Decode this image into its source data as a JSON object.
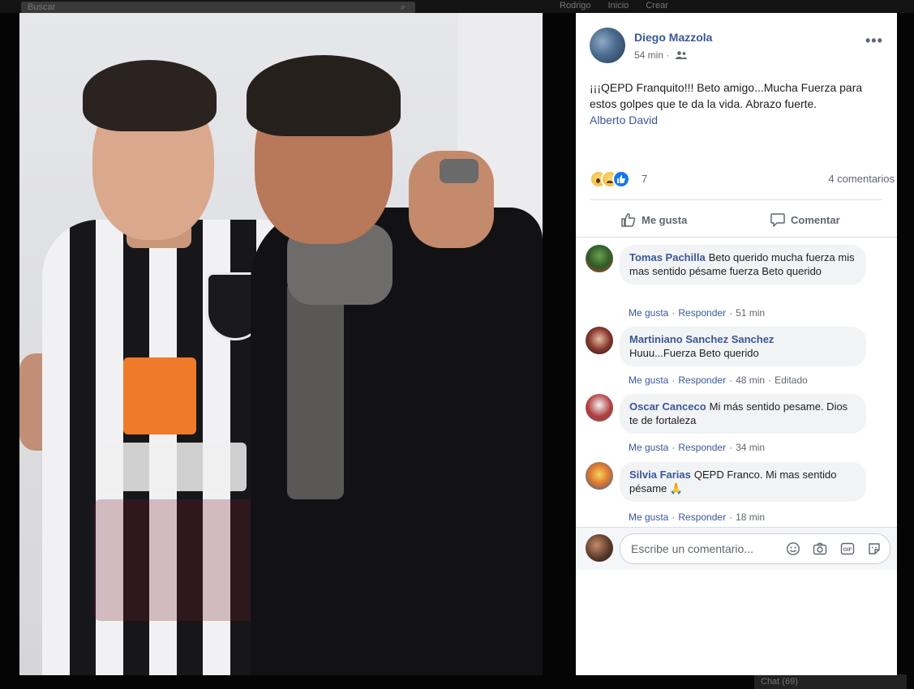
{
  "background": {
    "search_placeholder": "Buscar",
    "nav_items": [
      "Rodrigo",
      "Inicio",
      "Crear"
    ],
    "chat_label": "Chat (69)"
  },
  "post": {
    "author": "Diego Mazzola",
    "time": "54 min",
    "separator": "·",
    "audience_icon": "group-icon",
    "more_icon": "more-options-icon",
    "text": "¡¡¡QEPD Franquito!!! Beto amigo...Mucha Fuerza para estos golpes que te da la vida. Abrazo fuerte.",
    "tagged_person": "Alberto David",
    "reaction_icons": [
      "wow-icon",
      "sad-icon",
      "like-icon"
    ],
    "reaction_count": "7",
    "comments_count": "4 comentarios",
    "like_label": "Me gusta",
    "comment_label": "Comentar"
  },
  "comments": [
    {
      "name": "Tomas Pachilla",
      "text": "Beto querido mucha fuerza mis mas sentido pésame fuerza Beto querido",
      "like": "Me gusta",
      "reply": "Responder",
      "time": "51 min",
      "edited": ""
    },
    {
      "name": "Martiniano Sanchez Sanchez",
      "text": "Huuu...Fuerza Beto querido",
      "like": "Me gusta",
      "reply": "Responder",
      "time": "48 min",
      "edited": "Editado"
    },
    {
      "name": "Oscar Canceco",
      "text": "Mi más sentido pesame. Dios te de fortaleza",
      "like": "Me gusta",
      "reply": "Responder",
      "time": "34 min",
      "edited": ""
    },
    {
      "name": "Silvia Farias",
      "text": "QEPD Franco. Mi mas sentido pésame 🙏",
      "like": "Me gusta",
      "reply": "Responder",
      "time": "18 min",
      "edited": ""
    }
  ],
  "compose": {
    "placeholder": "Escribe un comentario...",
    "icons": [
      "emoji-icon",
      "camera-icon",
      "gif-icon",
      "sticker-icon"
    ]
  },
  "colors": {
    "link": "#385898",
    "secondary_text": "#606770",
    "bubble": "#f2f3f5",
    "like_blue": "#1877f2"
  }
}
